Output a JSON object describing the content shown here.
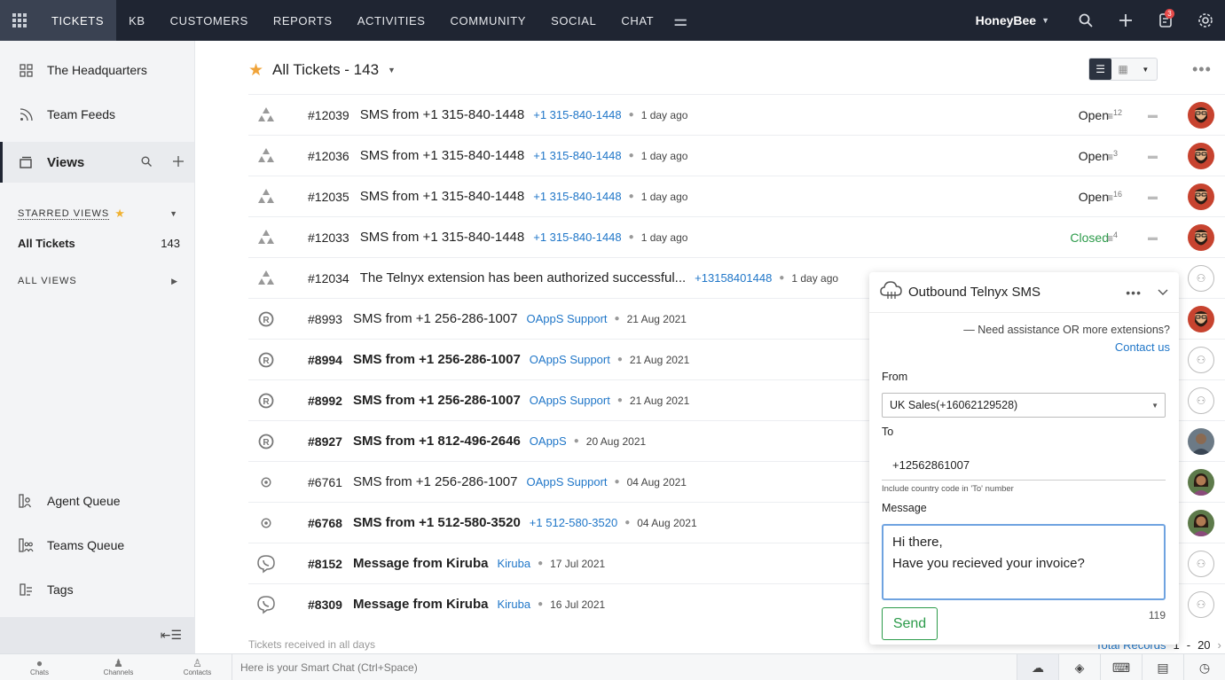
{
  "topnav": {
    "items": [
      "TICKETS",
      "KB",
      "CUSTOMERS",
      "REPORTS",
      "ACTIVITIES",
      "COMMUNITY",
      "SOCIAL",
      "CHAT"
    ],
    "active": "TICKETS",
    "org_name": "HoneyBee",
    "notification_count": "3"
  },
  "sidebar": {
    "headquarters": "The Headquarters",
    "team_feeds": "Team Feeds",
    "views": "Views",
    "starred_views": "STARRED VIEWS",
    "all_tickets_label": "All Tickets",
    "all_tickets_count": "143",
    "all_views": "ALL VIEWS",
    "agent_queue": "Agent Queue",
    "teams_queue": "Teams Queue",
    "tags": "Tags"
  },
  "list": {
    "title": "All Tickets - 143",
    "footer": "Tickets received in all days",
    "pager_label": "Total Records",
    "pager_page": "1",
    "pager_total": "20",
    "tickets": [
      {
        "id": "#12039",
        "subject": "SMS from +1 315-840-1448",
        "contact": "+1 315-840-1448",
        "date": "1 day ago",
        "status": "Open",
        "threads": "12",
        "icon": "telnyx",
        "bold": false,
        "avatar": "bearded"
      },
      {
        "id": "#12036",
        "subject": "SMS from +1 315-840-1448",
        "contact": "+1 315-840-1448",
        "date": "1 day ago",
        "status": "Open",
        "threads": "3",
        "icon": "telnyx",
        "bold": false,
        "avatar": "bearded"
      },
      {
        "id": "#12035",
        "subject": "SMS from +1 315-840-1448",
        "contact": "+1 315-840-1448",
        "date": "1 day ago",
        "status": "Open",
        "threads": "16",
        "icon": "telnyx",
        "bold": false,
        "avatar": "bearded"
      },
      {
        "id": "#12033",
        "subject": "SMS from +1 315-840-1448",
        "contact": "+1 315-840-1448",
        "date": "1 day ago",
        "status": "Closed",
        "threads": "4",
        "icon": "telnyx",
        "bold": false,
        "avatar": "bearded"
      },
      {
        "id": "#12034",
        "subject": "The Telnyx extension has been authorized successful...",
        "contact": "+13158401448",
        "date": "1 day ago",
        "status": "",
        "threads": "",
        "icon": "telnyx",
        "bold": false,
        "avatar": "none"
      },
      {
        "id": "#8993",
        "subject": "SMS from +1 256-286-1007",
        "contact": "OAppS Support",
        "date": "21 Aug 2021",
        "status": "",
        "threads": "",
        "icon": "registered",
        "bold": false,
        "avatar": "bearded"
      },
      {
        "id": "#8994",
        "subject": "SMS from +1 256-286-1007",
        "contact": "OAppS Support",
        "date": "21 Aug 2021",
        "status": "",
        "threads": "",
        "icon": "registered",
        "bold": true,
        "avatar": "none"
      },
      {
        "id": "#8992",
        "subject": "SMS from +1 256-286-1007",
        "contact": "OAppS Support",
        "date": "21 Aug 2021",
        "status": "",
        "threads": "",
        "icon": "registered",
        "bold": true,
        "avatar": "none"
      },
      {
        "id": "#8927",
        "subject": "SMS from +1 812-496-2646",
        "contact": "OAppS",
        "date": "20 Aug 2021",
        "status": "",
        "threads": "",
        "icon": "registered",
        "bold": true,
        "avatar": "man"
      },
      {
        "id": "#6761",
        "subject": "SMS from +1 256-286-1007",
        "contact": "OAppS Support",
        "date": "04 Aug 2021",
        "status": "",
        "threads": "",
        "icon": "small-circle",
        "bold": false,
        "avatar": "woman"
      },
      {
        "id": "#6768",
        "subject": "SMS from +1 512-580-3520",
        "contact": "+1 512-580-3520",
        "date": "04 Aug 2021",
        "status": "",
        "threads": "",
        "icon": "small-circle",
        "bold": true,
        "avatar": "woman"
      },
      {
        "id": "#8152",
        "subject": "Message from Kiruba",
        "contact": "Kiruba",
        "date": "17 Jul 2021",
        "status": "",
        "threads": "",
        "icon": "viber",
        "bold": true,
        "avatar": "none"
      },
      {
        "id": "#8309",
        "subject": "Message from Kiruba",
        "contact": "Kiruba",
        "date": "16 Jul 2021",
        "status": "",
        "threads": "",
        "icon": "viber",
        "bold": true,
        "avatar": "none"
      }
    ]
  },
  "sms_panel": {
    "title": "Outbound Telnyx SMS",
    "assistance": "— Need assistance OR more extensions?",
    "contact_us": "Contact us",
    "from_label": "From",
    "from_value": "UK Sales(+16062129528)",
    "to_label": "To",
    "to_value": "+12562861007",
    "to_hint": "Include country code in 'To' number",
    "message_label": "Message",
    "message_line1": "Hi there,",
    "message_line2": "Have you recieved your invoice?",
    "char_count": "119",
    "send_label": "Send"
  },
  "bottombar": {
    "chats": "Chats",
    "channels": "Channels",
    "contacts": "Contacts",
    "smart_chat_placeholder": "Here is your Smart Chat (Ctrl+Space)"
  }
}
